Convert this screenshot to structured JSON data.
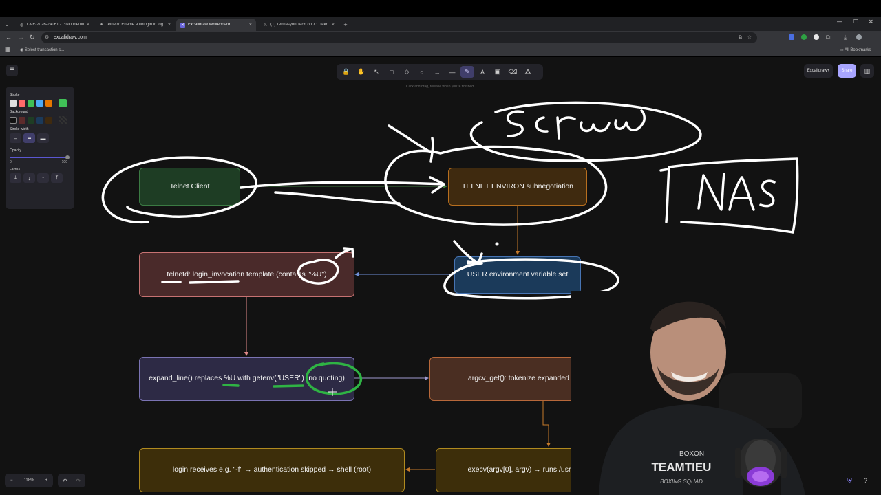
{
  "browser": {
    "tabs": [
      {
        "title": "CVE-2026-24061 - GNU Inetutil",
        "icon": "bug-icon",
        "active": false
      },
      {
        "title": "telnetd: Enable autologin in log",
        "icon": "github-icon",
        "active": false
      },
      {
        "title": "Excalidraw Whiteboard",
        "icon": "excalidraw-icon",
        "active": true
      },
      {
        "title": "(1) Teknasyon Tech on X: \"Tekn",
        "icon": "x-icon",
        "active": false
      }
    ],
    "new_tab": "+",
    "close_glyph": "×",
    "url": "excalidraw.com",
    "bookmark_item": "Select transaction s...",
    "all_bookmarks": "All Bookmarks"
  },
  "toolbar": {
    "tools": [
      {
        "name": "lock-icon",
        "glyph": "🔒"
      },
      {
        "name": "hand-icon",
        "glyph": "✋"
      },
      {
        "name": "pointer-icon",
        "glyph": "↖"
      },
      {
        "name": "rectangle-icon",
        "glyph": "□"
      },
      {
        "name": "diamond-icon",
        "glyph": "◇"
      },
      {
        "name": "ellipse-icon",
        "glyph": "○"
      },
      {
        "name": "arrow-icon",
        "glyph": "→"
      },
      {
        "name": "line-icon",
        "glyph": "—"
      },
      {
        "name": "pencil-icon",
        "glyph": "✎",
        "active": true
      },
      {
        "name": "text-icon",
        "glyph": "A"
      },
      {
        "name": "image-icon",
        "glyph": "▣"
      },
      {
        "name": "eraser-icon",
        "glyph": "⌫"
      },
      {
        "name": "extra-tools-icon",
        "glyph": "⁂"
      }
    ],
    "hint": "Click and drag, release when you're finished"
  },
  "top_right": {
    "excalidraw_plus": "Excalidraw+",
    "share": "Share"
  },
  "panel": {
    "stroke_label": "Stroke",
    "stroke_colors": [
      "#e0e0e0",
      "#ff6b6b",
      "#40c057",
      "#4dabf7",
      "#e67700"
    ],
    "stroke_selected": "#40c057",
    "background_label": "Background",
    "background_colors": [
      "#121212",
      "#5c2b2b",
      "#1e3d24",
      "#1b3a5a",
      "#3f2a0f"
    ],
    "stroke_width_label": "Stroke width",
    "opacity_label": "Opacity",
    "opacity_min": "0",
    "opacity_max": "100",
    "opacity_value": 100,
    "layers_label": "Layers"
  },
  "diagram": {
    "telnet_client": "Telnet Client",
    "environ": "TELNET ENVIRON subnegotiation",
    "user_env": "USER environment variable set",
    "template": "telnetd: login_invocation template (contains \"%U\")",
    "expand": "expand_line() replaces %U with getenv(\"USER\") (no quoting)",
    "argcv": "argcv_get(): tokenize expanded string → argv[]",
    "login": "login receives e.g. \"-f\" → authentication skipped → shell (root)",
    "execv": "execv(argv[0], argv) → runs /usr/bin/login with args"
  },
  "colors": {
    "green_box": "#1e3d24",
    "brown_box": "#3f2a0f",
    "blue_box": "#1b3a5a",
    "red_box": "#4a2a2a",
    "purple_box": "#2d2a45",
    "sketch_white": "#ffffff",
    "sketch_green": "#2fb344"
  },
  "zoom": {
    "minus": "−",
    "value": "118%",
    "plus": "+"
  },
  "undo": {
    "undo": "↶",
    "redo": "↷"
  },
  "webcam": {
    "shirt_text_1": "BOXON",
    "shirt_text_2": "TEAMTIEU",
    "shirt_text_3": "BOXING SQUAD"
  }
}
